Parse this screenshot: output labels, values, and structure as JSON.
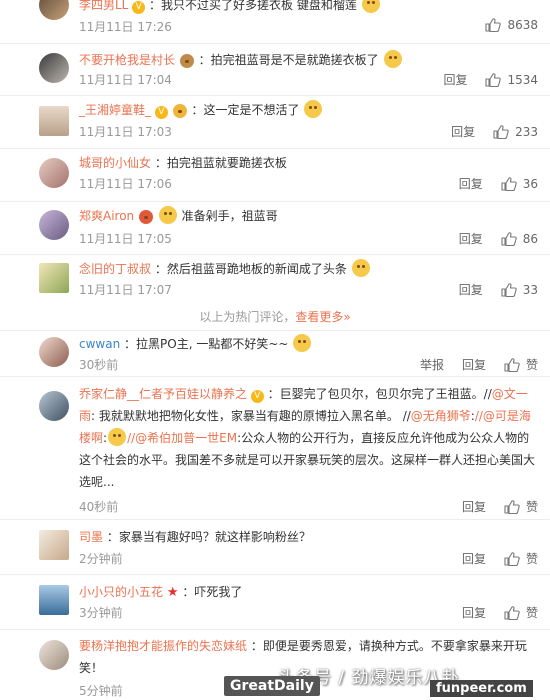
{
  "divider": {
    "text": "以上为热门评论，",
    "link": "查看更多»"
  },
  "comments": [
    {
      "user": "李四男LL",
      "badge": "V",
      "text": "：我只不过买了好多搓衣板 键盘和榴莲",
      "time": "11月11日 17:26",
      "reply": "回复",
      "likes": "8638"
    },
    {
      "user": "不要开枪我是村长",
      "text": "：拍完祖蓝哥是不是就跪搓衣板了",
      "time": "11月11日 17:04",
      "reply": "回复",
      "likes": "1534"
    },
    {
      "user": "_王湘婷童鞋_",
      "badge": "V",
      "text": "：这一定是不想活了",
      "time": "11月11日 17:03",
      "reply": "回复",
      "likes": "233"
    },
    {
      "user": "城哥的小仙女",
      "text": "：拍完祖蓝就要跪搓衣板",
      "time": "11月11日 17:06",
      "reply": "回复",
      "likes": "36"
    },
    {
      "user": "郑爽Airon",
      "text": "准备剁手，祖蓝哥",
      "time": "11月11日 17:05",
      "reply": "回复",
      "likes": "86"
    },
    {
      "user": "念旧的丁叔叔",
      "text": "：然后祖蓝哥跪地板的新闻成了头条",
      "time": "11月11日 17:07",
      "reply": "回复",
      "likes": "33"
    },
    {
      "user": "cwwan",
      "text": "：拉黑PO主, 一點都不好笑~~",
      "time": "30秒前",
      "report": "举报",
      "reply": "回复",
      "likes": "赞"
    },
    {
      "user": "乔家仁静__仁者予百娃以静养之",
      "badge": "V",
      "text_part1": "：巨婴完了包贝尔，包贝尔完了王祖蓝。//",
      "at1": "@文一雨",
      "text_part2": ": 我就默默地把物化女性，家暴当有趣的原博拉入黑名单。 //",
      "at2": "@无角狮爷",
      "text_part3": ":",
      "at3": "//@可是海楼啊",
      "text_part4": ":",
      "at4": "//@希伯加普一世EM",
      "text_part5": ":公众人物的公开行为，直接反应允许他成为公众人物的这个社会的水平。我国差不多就是可以开家暴玩笑的层次。这屎样一群人还担心美国大选呢...",
      "time": "40秒前",
      "reply": "回复",
      "likes": "赞"
    },
    {
      "user": "司墨",
      "text": "：家暴当有趣好吗？就这样影响粉丝？",
      "time": "2分钟前",
      "reply": "回复",
      "likes": "赞"
    },
    {
      "user": "小小只的小五花",
      "text": "：吓死我了",
      "time": "3分钟前",
      "reply": "回复",
      "likes": "赞"
    },
    {
      "user": "要杨洋抱抱才能振作的失恋妹纸",
      "text": "：即便是要秀恩爱，请换种方式。不要拿家暴来开玩笑！",
      "time": "5分钟前",
      "reply": "回复",
      "likes": "赞"
    }
  ],
  "watermarks": {
    "toutiao": "头条号 / 劲爆娱乐八卦",
    "greatdaily": "GreatDaily",
    "funpeer": "funpeer.com"
  },
  "colors": {
    "name": "#eb7350",
    "link_blue": "#3a86c8",
    "time": "#999999"
  }
}
